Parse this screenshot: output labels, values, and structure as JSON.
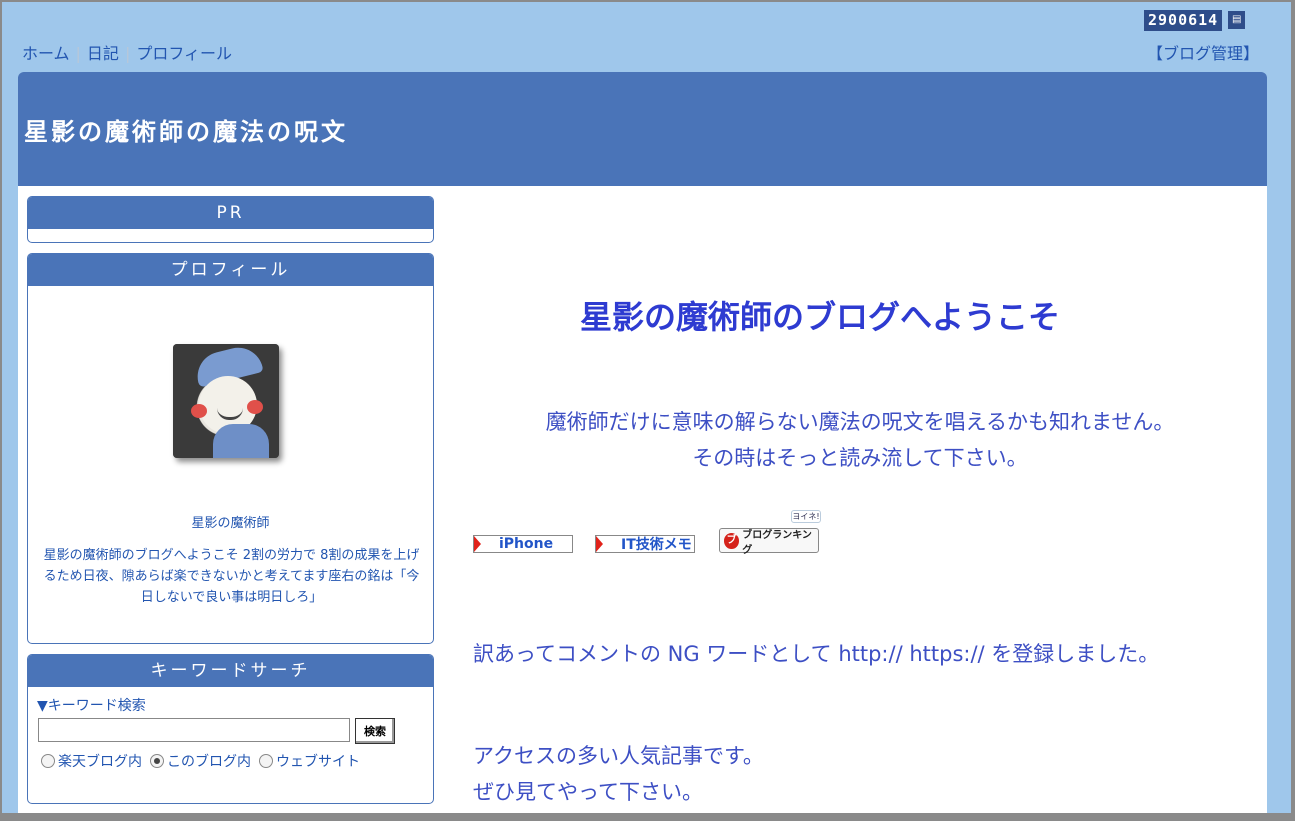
{
  "nav": {
    "home": "ホーム",
    "diary": "日記",
    "profile": "プロフィール"
  },
  "counter": {
    "value": "2900614"
  },
  "admin_link": "【ブログ管理】",
  "blog_title": "星影の魔術師の魔法の呪文",
  "sidebar": {
    "pr_title": "PR",
    "profile_title": "プロフィール",
    "profile_name": "星影の魔術師",
    "profile_desc": "星影の魔術師のブログへようこそ 2割の労力で 8割の成果を上げるため日夜、隙あらば楽できないかと考えてます座右の銘は「今日しないで良い事は明日しろ」",
    "keyword_title": "キーワードサーチ",
    "keyword_label": "▼キーワード検索",
    "search_button": "検索",
    "radio_rakuten": "楽天ブログ内",
    "radio_this": "このブログ内",
    "radio_web": "ウェブサイト"
  },
  "main": {
    "title": "星影の魔術師のブログへようこそ",
    "lead_line1": "魔術師だけに意味の解らない魔法の呪文を唱えるかも知れません。",
    "lead_line2": "その時はそっと読み流して下さい。",
    "badge_iphone": "iPhone",
    "badge_it": "IT技術メモ",
    "ranking": "ブログランキング",
    "yoine": "ヨイネ!",
    "notice": "訳あってコメントの NG ワードとして http:// https:// を登録しました。",
    "popular_line1": "アクセスの多い人気記事です。",
    "popular_line2": "ぜひ見てやって下さい。"
  }
}
